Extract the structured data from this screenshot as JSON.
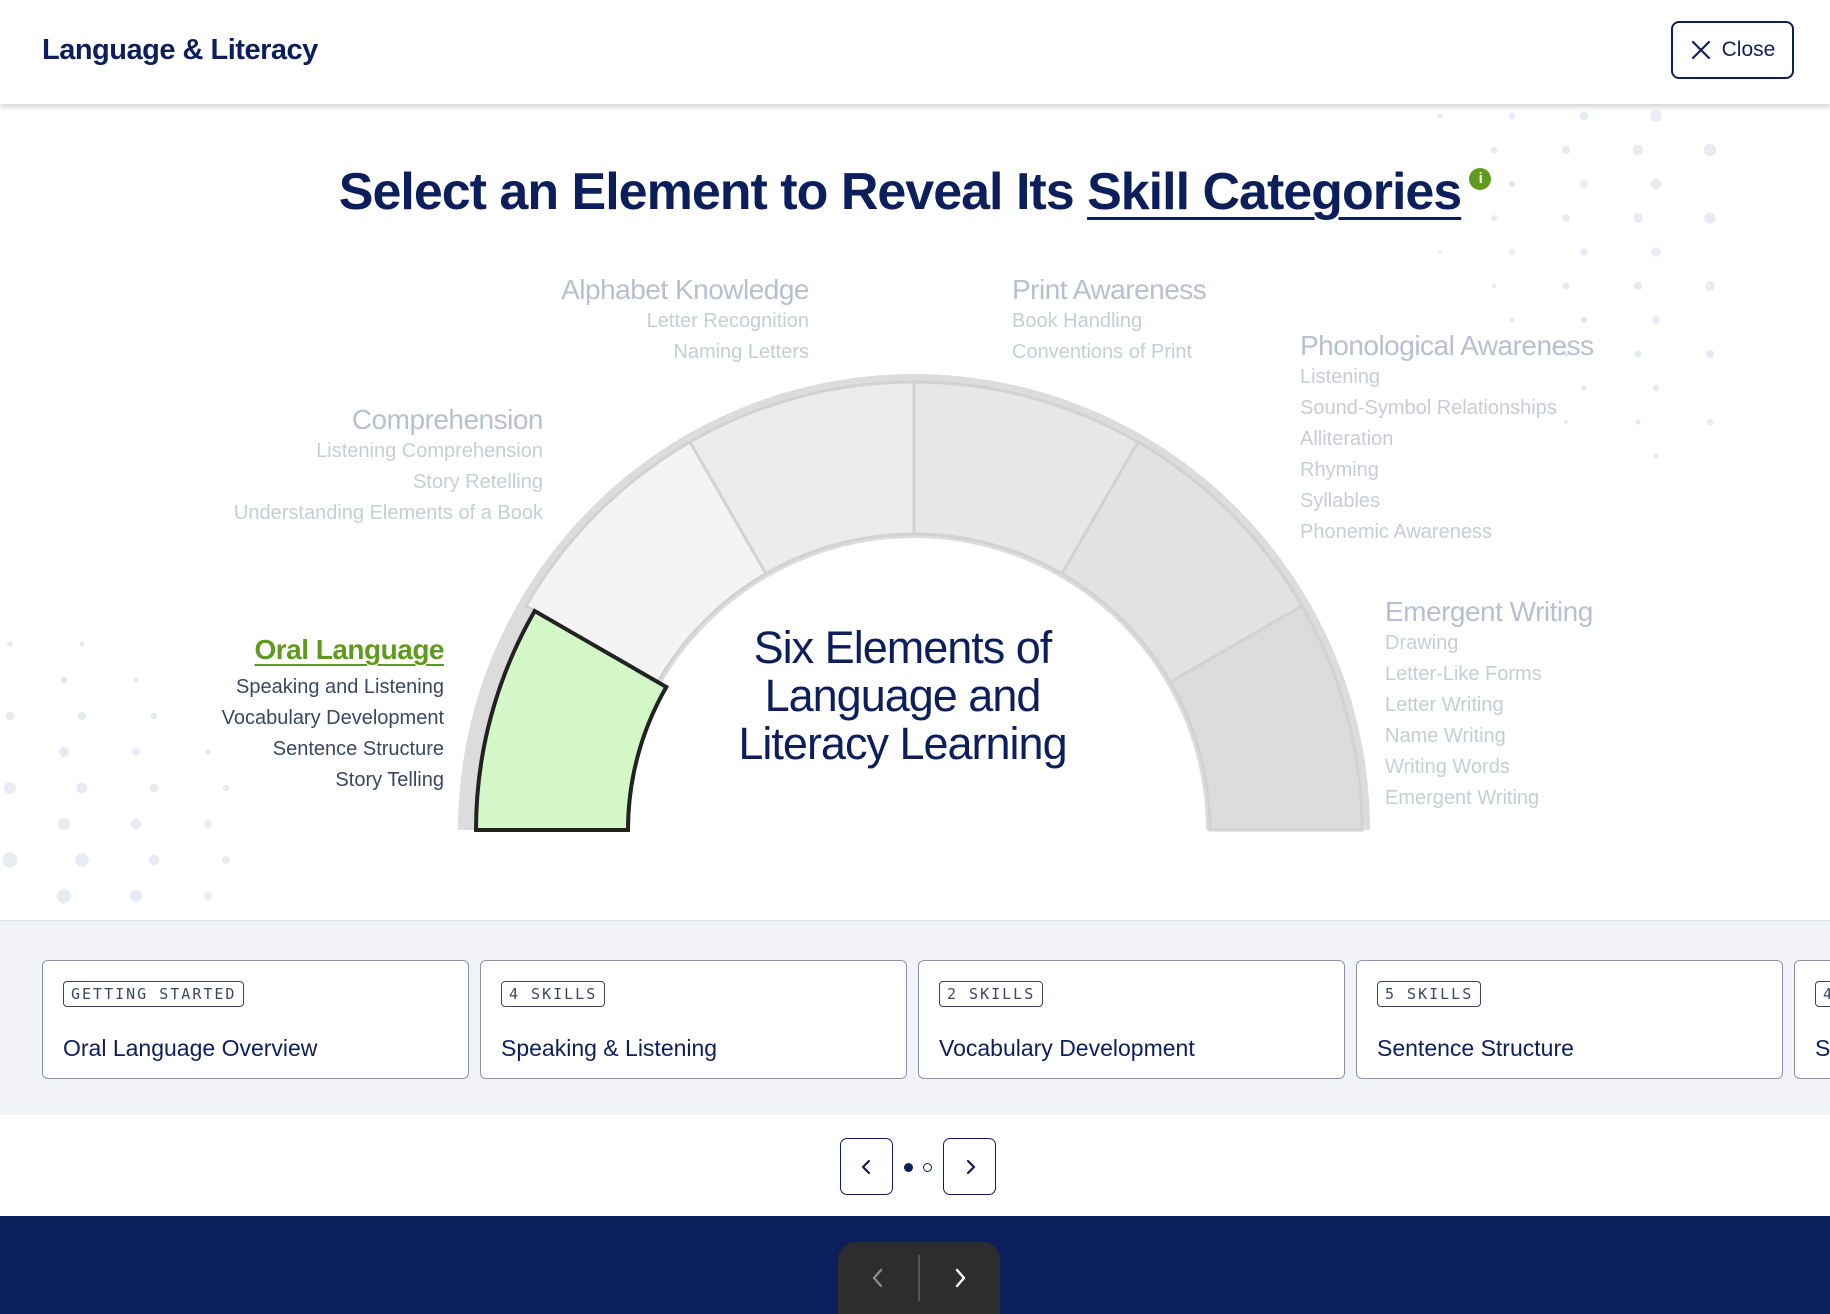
{
  "header": {
    "title": "Language & Literacy",
    "close_label": "Close"
  },
  "headline": {
    "prefix": "Select an Element to Reveal Its ",
    "link": "Skill Categories",
    "info": "i"
  },
  "center_text": "Six Elements of Language and Literacy Learning",
  "elements": [
    {
      "title": "Oral Language",
      "active": true,
      "items": [
        "Speaking and Listening",
        "Vocabulary Development",
        "Sentence Structure",
        "Story Telling"
      ]
    },
    {
      "title": "Comprehension",
      "active": false,
      "items": [
        "Listening Comprehension",
        "Story Retelling",
        "Understanding Elements of a Book"
      ]
    },
    {
      "title": "Alphabet Knowledge",
      "active": false,
      "items": [
        "Letter Recognition",
        "Naming Letters"
      ]
    },
    {
      "title": "Print Awareness",
      "active": false,
      "items": [
        "Book Handling",
        "Conventions of Print"
      ]
    },
    {
      "title": "Phonological Awareness",
      "active": false,
      "items": [
        "Listening",
        "Sound-Symbol Relationships",
        "Alliteration",
        "Rhyming",
        "Syllables",
        "Phonemic Awareness"
      ]
    },
    {
      "title": "Emergent Writing",
      "active": false,
      "items": [
        "Drawing",
        "Letter-Like Forms",
        "Letter Writing",
        "Name Writing",
        "Writing Words",
        "Emergent Writing"
      ]
    }
  ],
  "cards": [
    {
      "tag": "GETTING STARTED",
      "title": "Oral Language Overview"
    },
    {
      "tag": "4 SKILLS",
      "title": "Speaking & Listening"
    },
    {
      "tag": "2 SKILLS",
      "title": "Vocabulary Development"
    },
    {
      "tag": "5 SKILLS",
      "title": "Sentence Structure"
    },
    {
      "tag": "4",
      "title": "S"
    }
  ],
  "pager": {
    "pages": 2,
    "current": 1
  },
  "colors": {
    "navy": "#0c1f5c",
    "accent_green": "#5f9a1f",
    "active_fill": "#d4f7c8",
    "bottom_bar": "#0b1f5b"
  }
}
